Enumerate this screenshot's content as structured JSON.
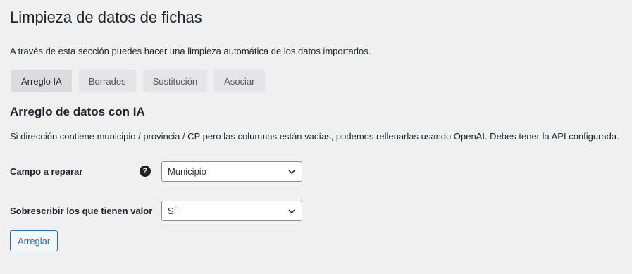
{
  "page": {
    "title": "Limpieza de datos de fichas",
    "intro": "A través de esta sección puedes hacer una limpieza automática de los datos importados."
  },
  "tabs": [
    {
      "label": "Arreglo IA",
      "active": true
    },
    {
      "label": "Borrados",
      "active": false
    },
    {
      "label": "Sustitución",
      "active": false
    },
    {
      "label": "Asociar",
      "active": false
    }
  ],
  "section": {
    "title": "Arreglo de datos con IA",
    "description": "Si dirección contiene municipio / provincia / CP pero las columnas están vacías, podemos rellenarlas usando OpenAI. Debes tener la API configurada."
  },
  "fields": {
    "campo": {
      "label": "Campo a reparar",
      "value": "Municipio",
      "help_icon": "question-circle-icon"
    },
    "sobrescribir": {
      "label": "Sobrescribir los que tienen valor",
      "value": "Sí"
    }
  },
  "actions": {
    "submit_label": "Arreglar"
  },
  "colors": {
    "background": "#f0f0f1",
    "accent": "#2271b1",
    "text": "#1d2327"
  }
}
